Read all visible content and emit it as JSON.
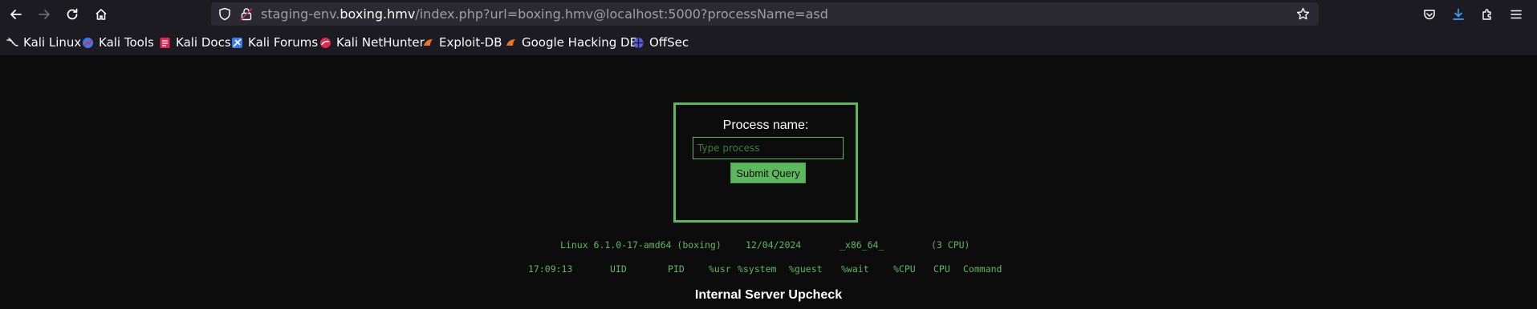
{
  "browser": {
    "url_prefix": "staging-env.",
    "url_domain": "boxing.hmv",
    "url_path": "/index.php?url=boxing.hmv@localhost:5000?processName=asd",
    "bookmarks": [
      {
        "label": "Kali Linux",
        "icon": "kali-dragon-icon"
      },
      {
        "label": "Kali Tools",
        "icon": "kali-tools-icon"
      },
      {
        "label": "Kali Docs",
        "icon": "kali-docs-icon"
      },
      {
        "label": "Kali Forums",
        "icon": "kali-forums-icon"
      },
      {
        "label": "Kali NetHunter",
        "icon": "kali-nethunter-icon"
      },
      {
        "label": "Exploit-DB",
        "icon": "exploit-db-icon"
      },
      {
        "label": "Google Hacking DB",
        "icon": "ghdb-icon"
      },
      {
        "label": "OffSec",
        "icon": "offsec-icon"
      }
    ]
  },
  "page": {
    "form": {
      "title": "Process name:",
      "placeholder": "Type process",
      "submit_label": "Submit Query"
    },
    "output": {
      "sys": {
        "os": "Linux 6.1.0-17-amd64 (boxing)",
        "date": "12/04/2024",
        "arch": "_x86_64_",
        "cpu": "(3 CPU)"
      },
      "header": {
        "time": "17:09:13",
        "uid": "UID",
        "pid": "PID",
        "usr": "%usr",
        "system": "%system",
        "guest": "%guest",
        "wait": "%wait",
        "cpu_pct": "%CPU",
        "cpu": "CPU",
        "command": "Command"
      }
    },
    "footer_title": "Internal Server Upcheck"
  },
  "colors": {
    "accent": "#5cb85c",
    "background": "#0c0c0d",
    "chrome": "#1c1b22",
    "urlbar": "#2b2a33"
  }
}
